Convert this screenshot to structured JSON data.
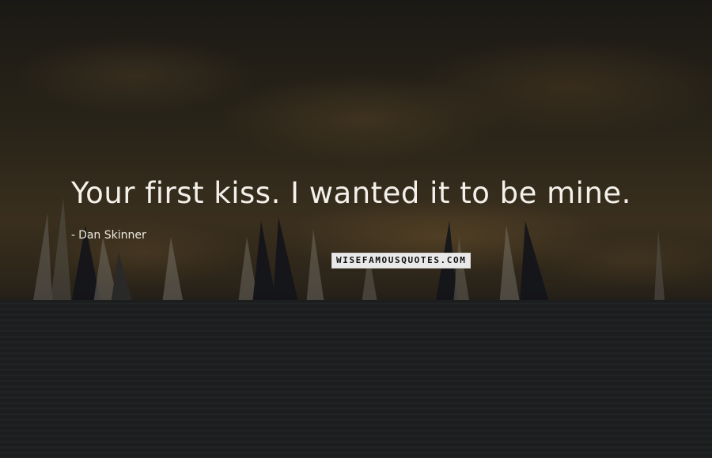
{
  "quote": {
    "text": "Your first kiss. I wanted it to be mine.",
    "author": "Dan Skinner",
    "author_prefix": "-"
  },
  "watermark": {
    "text": "WISEFAMOUSQUOTES.COM"
  },
  "colors": {
    "quote_text": "#f4f1ea",
    "watermark_bg": "#e9e9e9",
    "sea": "#1c1d1e",
    "sky": "#2a2519"
  }
}
